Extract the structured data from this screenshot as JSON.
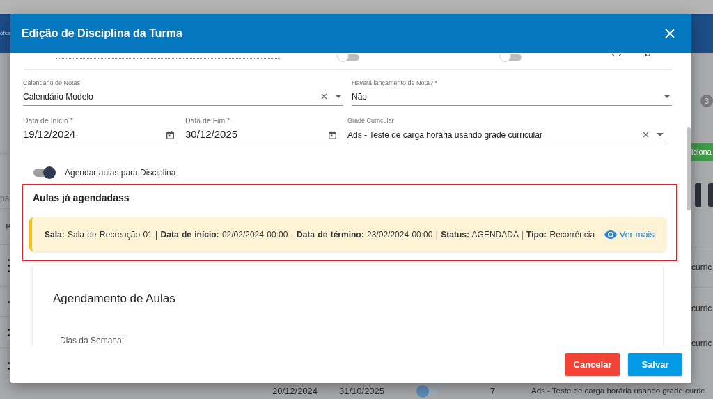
{
  "background": {
    "header_text": "ofes",
    "badge": "3",
    "button": "iciona",
    "input": {
      "placeholder": "pa"
    },
    "column_1": "P",
    "cells": [
      "curric",
      "curric",
      "curric"
    ],
    "row": {
      "start": "20/12/2024",
      "end": "31/10/2025",
      "toggle": {
        "on": false
      },
      "count": "7",
      "grade": "Ads - Teste de carga horária usando grade curric"
    }
  },
  "dialog": {
    "title": "Edição de Disciplina da Turma",
    "partial_row": {
      "toggles": [
        {
          "on": false
        },
        {
          "on": false
        }
      ]
    },
    "field_rows": [
      [
        {
          "kind": "select",
          "label": "Calendário de Notas",
          "value": "Calendário Modelo",
          "clearable": true
        },
        {
          "kind": "select",
          "label": "Haverá lançamento de Nota? *",
          "value": "Não",
          "clearable": false
        }
      ],
      [
        {
          "kind": "date",
          "label": "Data de Início *",
          "value": "19/12/2024"
        },
        {
          "kind": "date",
          "label": "Data de Fim *",
          "value": "30/12/2025"
        },
        {
          "kind": "select",
          "label": "Grade Curricular",
          "value": "Ads - Teste de carga horária usando grade curricular",
          "clearable": true
        }
      ]
    ],
    "schedule_toggle": {
      "label": "Agendar aulas para Disciplina",
      "on": true
    },
    "scheduled_classes": {
      "title": "Aulas já agendadass",
      "items": [
        {
          "text": "**Sala:** Sala de Recreação 01 | **Data de início:** 02/02/2024 00:00 - **Data de término:** 23/02/2024 00:00 | **Status:** AGENDADA | **Tipo:** Recorrência",
          "link": "Ver mais"
        }
      ]
    },
    "scheduling": {
      "title": "Agendamento de Aulas",
      "weekdays_label": "Dias da Semana:"
    },
    "buttons": [
      {
        "kind": "cancel",
        "label": "Cancelar"
      },
      {
        "kind": "save",
        "label": "Salvar"
      }
    ]
  }
}
